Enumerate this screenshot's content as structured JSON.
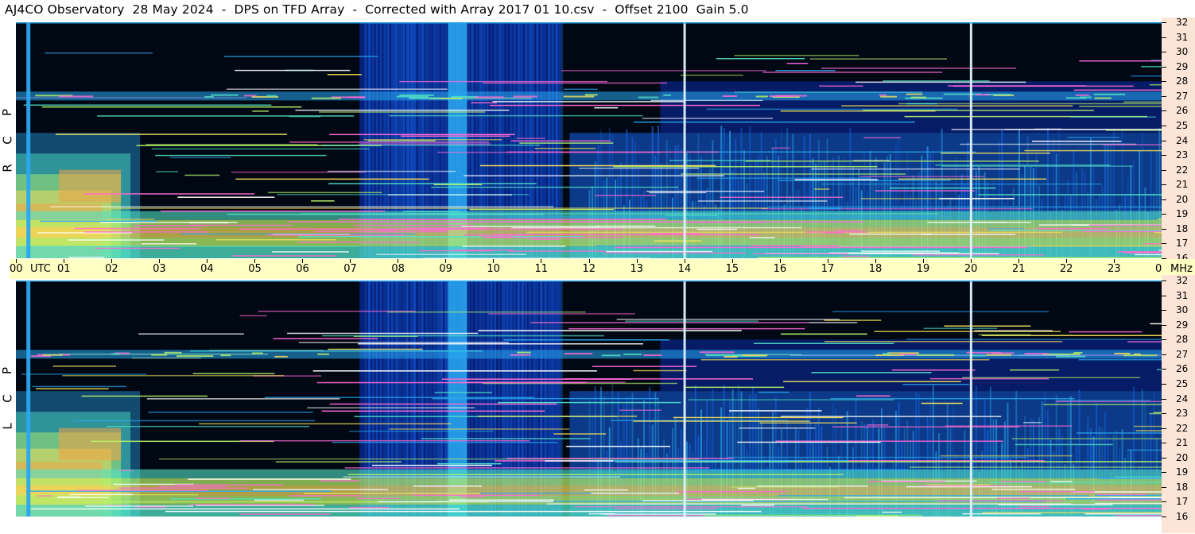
{
  "title": "AJ4CO Observatory  28 May 2024  -  DPS on TFD Array  -  Corrected with Array 2017 01 10.csv  -  Offset 2100  Gain 5.0",
  "panels": {
    "top": {
      "polarization": [
        "R",
        "C",
        "P"
      ]
    },
    "bottom": {
      "polarization": [
        "L",
        "C",
        "P"
      ]
    }
  },
  "time_axis": {
    "labels": [
      "00",
      "UTC",
      "01",
      "02",
      "03",
      "04",
      "05",
      "06",
      "07",
      "08",
      "09",
      "10",
      "11",
      "12",
      "13",
      "14",
      "15",
      "16",
      "17",
      "18",
      "19",
      "20",
      "21",
      "22",
      "23",
      "00"
    ],
    "unit": "MHz"
  },
  "chart_data": {
    "type": "heatmap",
    "title": "AJ4CO Observatory  28 May 2024  -  DPS on TFD Array  -  Corrected with Array 2017 01 10.csv  -  Offset 2100  Gain 5.0",
    "x": {
      "label": "UTC",
      "range": [
        0,
        24
      ],
      "ticks": [
        "00",
        "01",
        "02",
        "03",
        "04",
        "05",
        "06",
        "07",
        "08",
        "09",
        "10",
        "11",
        "12",
        "13",
        "14",
        "15",
        "16",
        "17",
        "18",
        "19",
        "20",
        "21",
        "22",
        "23",
        "00"
      ]
    },
    "y": {
      "label": "MHz",
      "range": [
        16,
        32
      ],
      "ticks": [
        32,
        31,
        30,
        29,
        28,
        27,
        26,
        25,
        24,
        23,
        22,
        21,
        20,
        19,
        18,
        17,
        16
      ]
    },
    "series": [
      {
        "name": "RCP"
      },
      {
        "name": "LCP"
      }
    ],
    "colorscale": [
      "#000814",
      "#0a2a9c",
      "#1565e8",
      "#2aa8f0",
      "#52e3c6",
      "#b8f36a",
      "#f5e05a",
      "#f5a040",
      "#ff6ad5",
      "#ffffff"
    ],
    "markers_utc": [
      14,
      20
    ]
  }
}
